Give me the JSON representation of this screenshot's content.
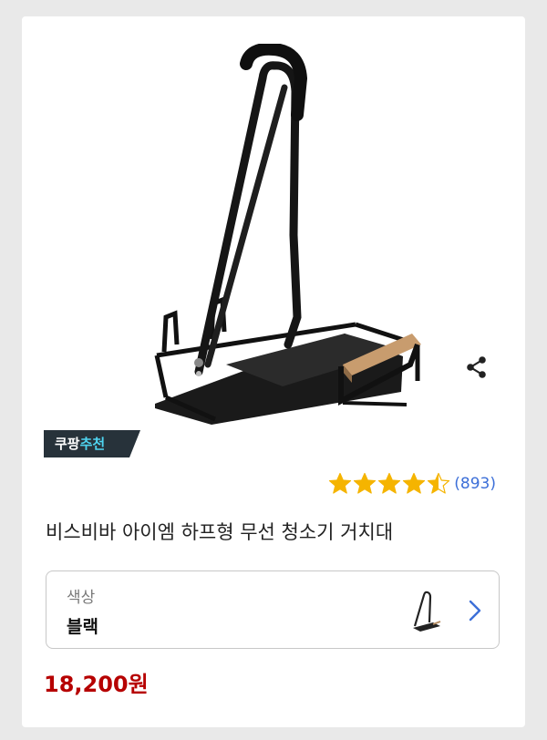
{
  "product": {
    "image_alt": "vacuum stand",
    "badge": {
      "part1": "쿠팡",
      "part2": "추천"
    },
    "rating": {
      "stars": 4.5,
      "count": "(893)"
    },
    "title": "비스비바 아이엠 하프형 무선 청소기 거치대",
    "option": {
      "label": "색상",
      "value": "블랙"
    },
    "price": "18,200원"
  },
  "colors": {
    "star": "#f5b400",
    "rating_count": "#3c6fd8",
    "price": "#b60000",
    "badge_bg": "#27323a",
    "badge_accent": "#4fd4f0",
    "chevron": "#3c6fd8"
  },
  "icons": {
    "share": "share-icon",
    "chevron": "chevron-right-icon"
  }
}
